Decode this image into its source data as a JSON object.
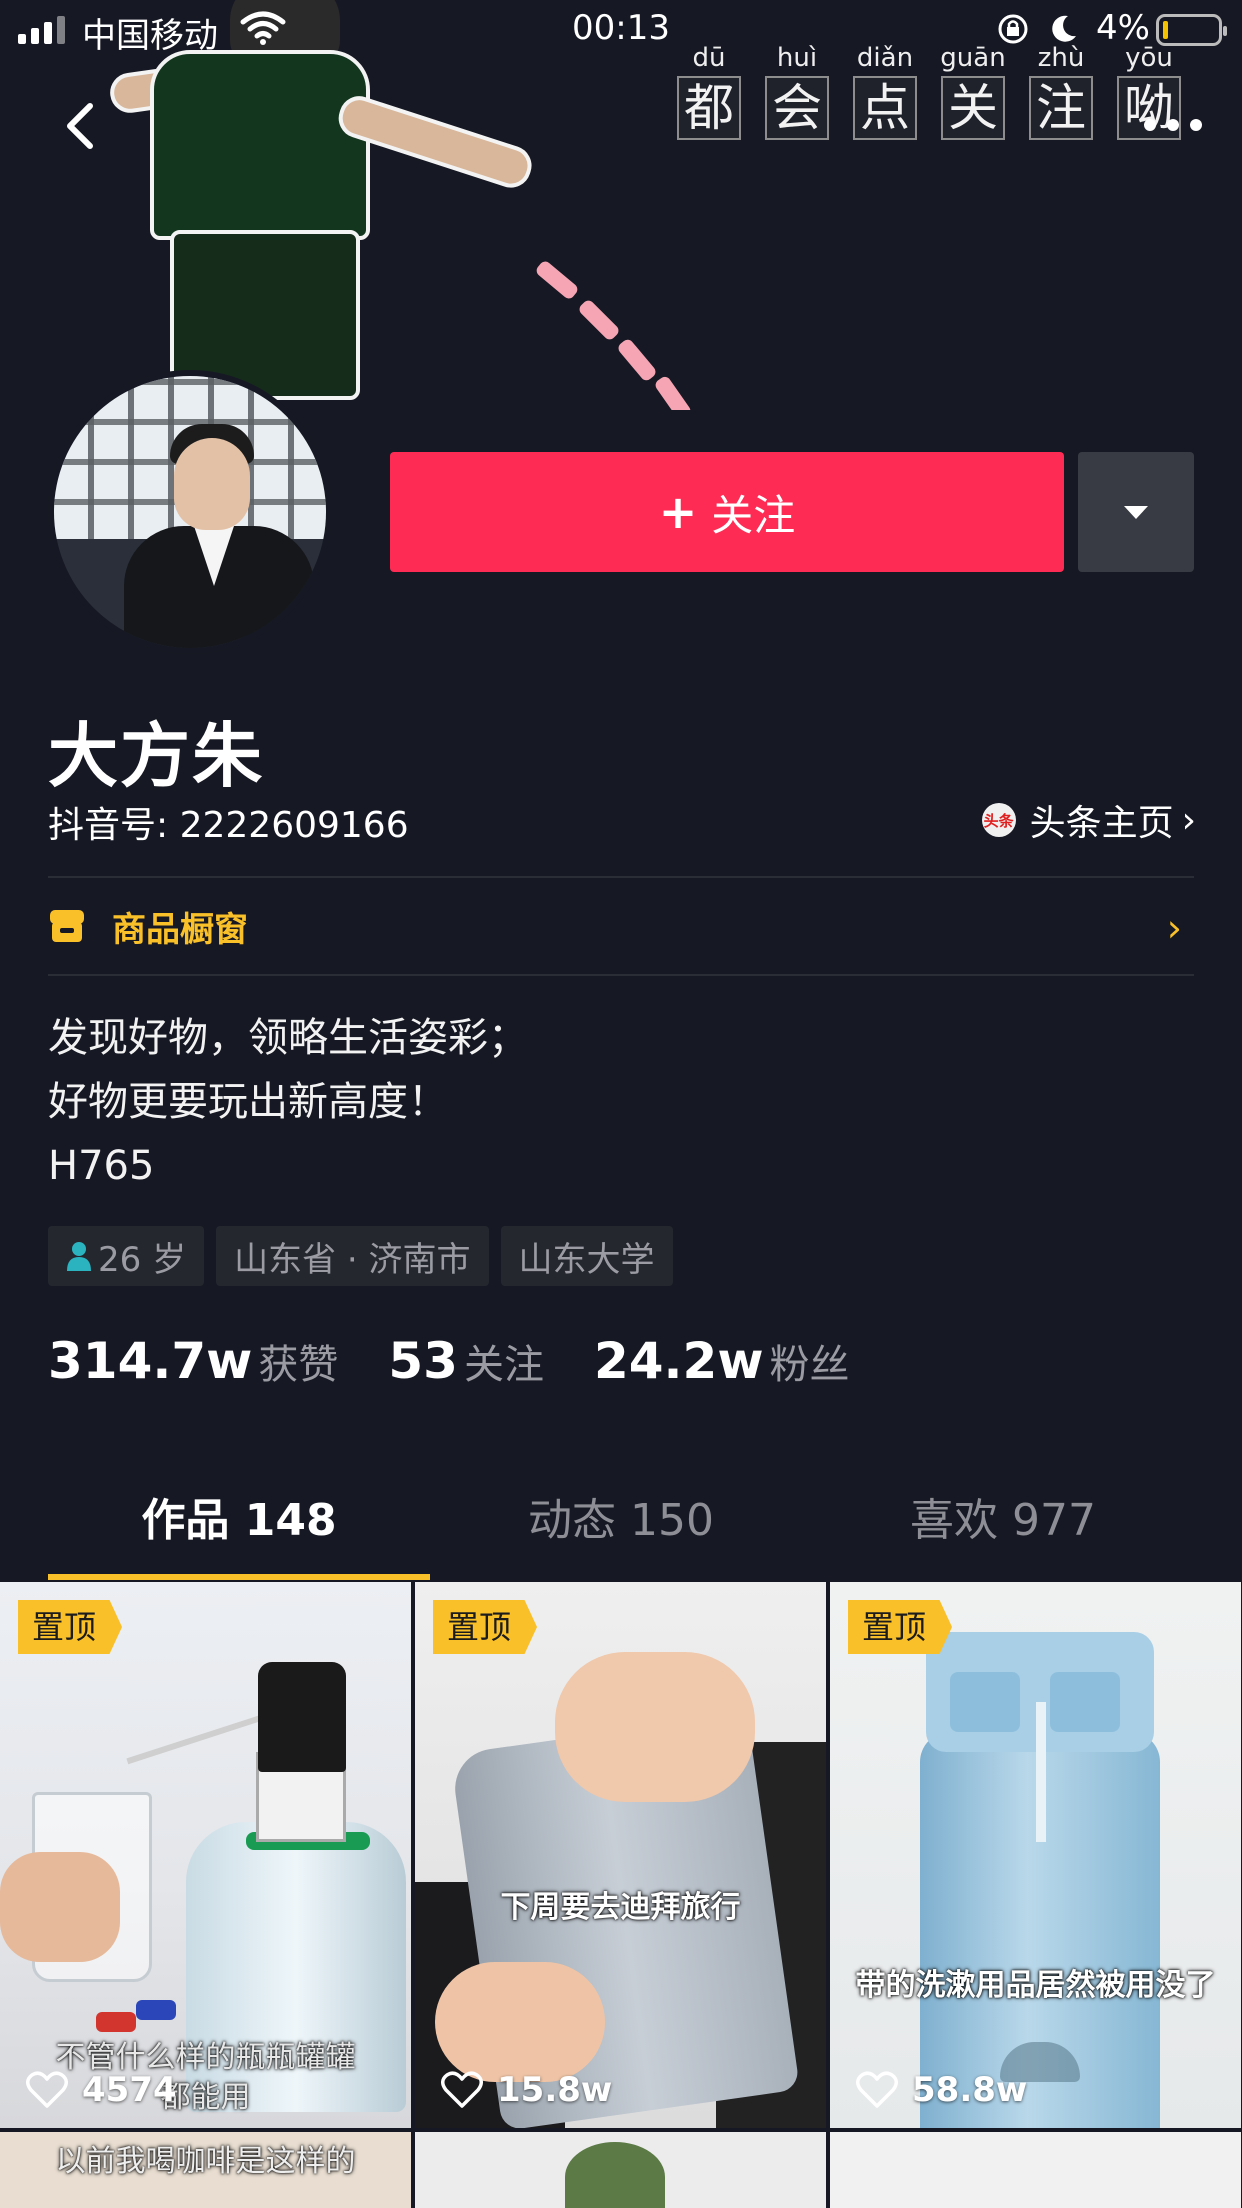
{
  "status_bar": {
    "carrier": "中国移动",
    "time": "00:13",
    "battery": "4%"
  },
  "banner": {
    "pinyin": [
      {
        "py": "dū",
        "hz": "都"
      },
      {
        "py": "huì",
        "hz": "会"
      },
      {
        "py": "diǎn",
        "hz": "点"
      },
      {
        "py": "guān",
        "hz": "关"
      },
      {
        "py": "zhù",
        "hz": "注"
      },
      {
        "py": "yōu",
        "hz": "呦"
      }
    ]
  },
  "profile": {
    "follow_label": "关注",
    "nickname": "大方朱",
    "douyin_id": "抖音号: 2222609166",
    "toutiao_icon_text": "头条",
    "toutiao_label": "头条主页",
    "shop_label": "商品橱窗",
    "bio_lines": [
      "发现好物，领略生活姿彩；",
      "好物更要玩出新高度！",
      "H765"
    ],
    "tags": [
      "26 岁",
      "山东省 · 济南市",
      "山东大学"
    ],
    "stats": [
      {
        "value": "314.7w",
        "label": "获赞"
      },
      {
        "value": "53",
        "label": "关注"
      },
      {
        "value": "24.2w",
        "label": "粉丝"
      }
    ]
  },
  "tabs": [
    {
      "label": "作品 148",
      "active": true
    },
    {
      "label": "动态 150",
      "active": false
    },
    {
      "label": "喜欢 977",
      "active": false
    }
  ],
  "videos": [
    {
      "pinned": "置顶",
      "likes": "4574",
      "caption": "不管什么样的瓶瓶罐罐",
      "caption2": "都能用"
    },
    {
      "pinned": "置顶",
      "likes": "15.8w",
      "caption": "下周要去迪拜旅行"
    },
    {
      "pinned": "置顶",
      "likes": "58.8w",
      "caption": "带的洗漱用品居然被用没了"
    },
    {
      "caption": "以前我喝咖啡是这样的"
    }
  ],
  "colors": {
    "background": "#161823",
    "follow_button": "#fe2c55",
    "accent_yellow": "#f9c02a"
  }
}
